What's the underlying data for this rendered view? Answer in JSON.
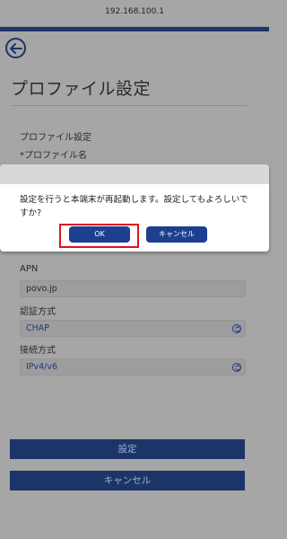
{
  "browser": {
    "url": "192.168.100.1"
  },
  "page": {
    "title": "プロファイル設定",
    "section_label": "プロファイル設定",
    "profile_name_label": "*プロファイル名",
    "apn_label": "APN",
    "apn_value": "povo.jp",
    "auth_label": "認証方式",
    "auth_value": "CHAP",
    "conn_label": "接続方式",
    "conn_value": "IPv4/v6",
    "submit_label": "設定",
    "cancel_label": "キャンセル"
  },
  "dialog": {
    "message": "設定を行うと本端末が再起動します。設定してもよろしいですか?",
    "ok_label": "OK",
    "cancel_label": "キャンセル"
  },
  "colors": {
    "brand": "#1b3569",
    "dialog_button": "#1d3f8f",
    "highlight": "#e01020",
    "overlay": "#a6a6a6"
  },
  "icons": {
    "back": "back-arrow-circle-icon",
    "select": "chevron-updown-icon"
  }
}
